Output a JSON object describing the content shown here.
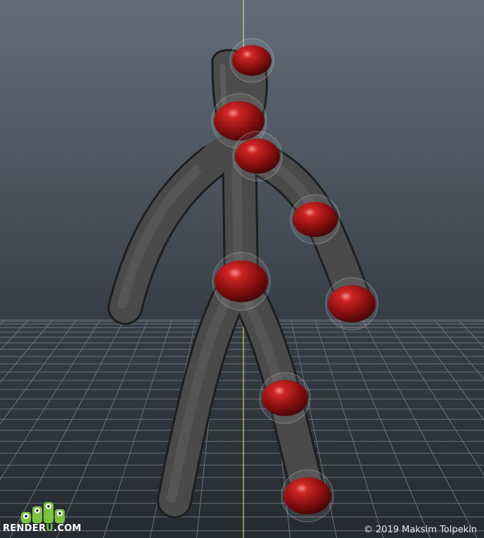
{
  "watermark": {
    "logo_icon": "green-monster-icon",
    "brand_prefix": "RENDER",
    "brand_accent": "U",
    "brand_suffix": ".COM",
    "brand_color": "#7bc142"
  },
  "credit": {
    "text": "© 2019 Maksim Tolpekin"
  },
  "colors": {
    "body": "#4a4a4a",
    "joint_control": "#b01818",
    "grid_line": "#6c7178",
    "axis_line": "#d8d84a"
  }
}
